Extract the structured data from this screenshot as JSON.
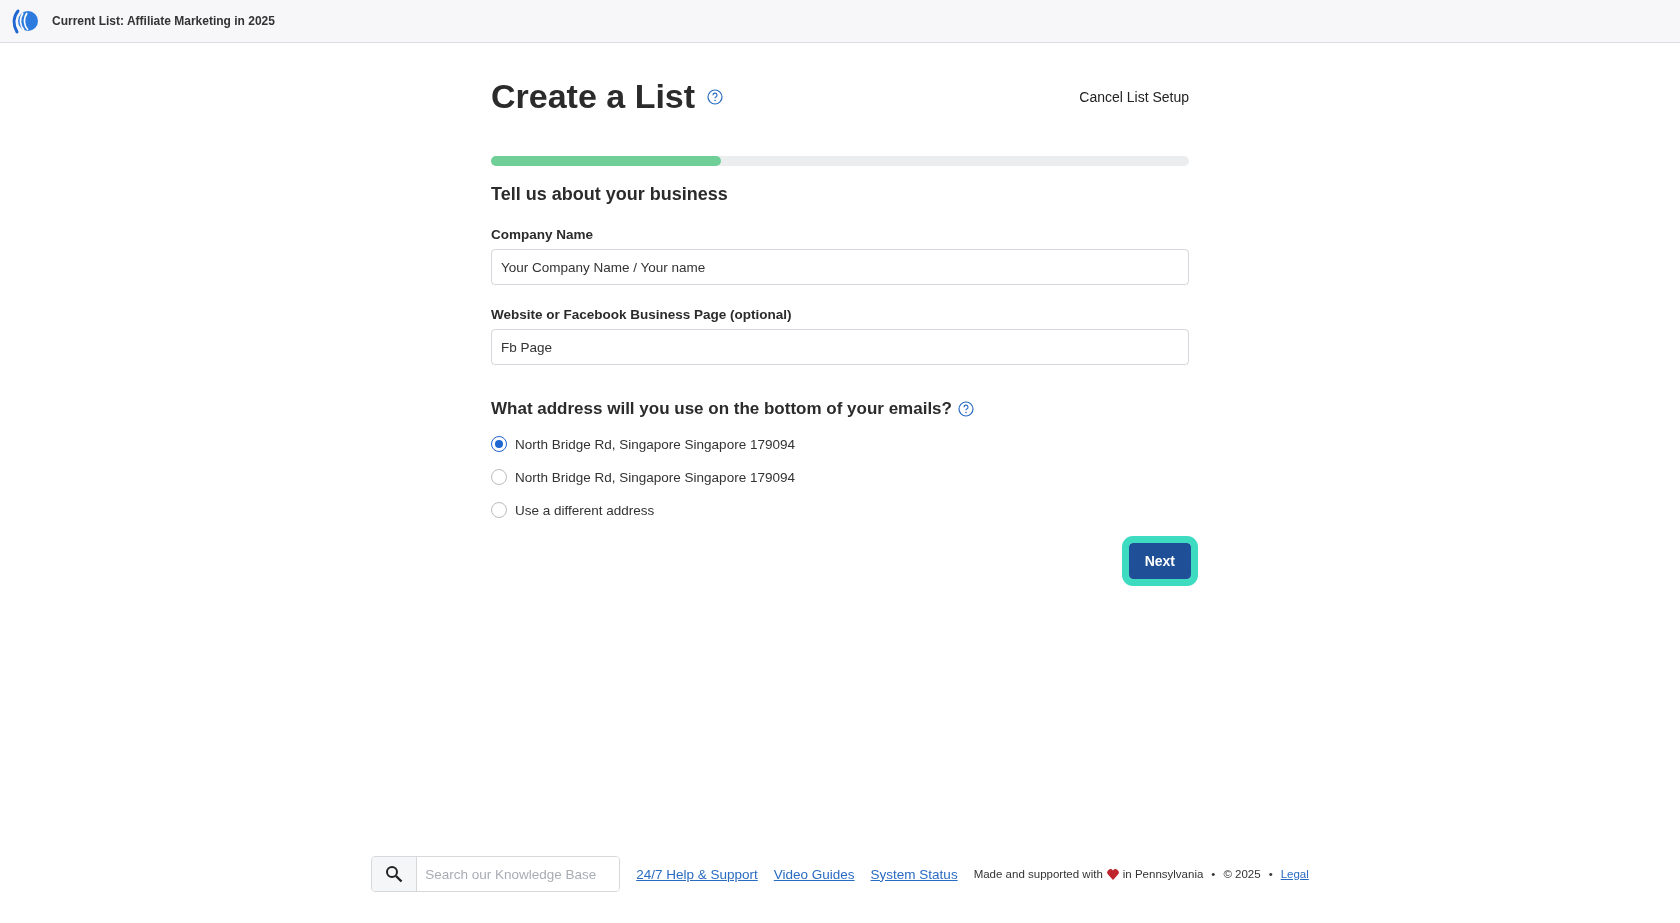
{
  "header": {
    "title": "Current List: Affiliate Marketing in 2025"
  },
  "page": {
    "title": "Create a List",
    "cancel": "Cancel List Setup"
  },
  "progress": {
    "level": 0.33
  },
  "section_title": "Tell us about your business",
  "fields": [
    {
      "label": "Company Name",
      "value": "Your Company Name / Your name"
    },
    {
      "label": "Website or Facebook Business Page (optional)",
      "value": "Fb Page"
    }
  ],
  "address": {
    "question": "What address will you use on the bottom of your emails?",
    "options": [
      {
        "label": "North Bridge Rd, Singapore Singapore 179094",
        "selected": true
      },
      {
        "label": "North Bridge Rd, Singapore Singapore 179094",
        "selected": false
      },
      {
        "label": "Use a different address",
        "selected": false
      }
    ]
  },
  "next_button": {
    "label": "Next",
    "focused": true
  },
  "footer": {
    "search": {
      "placeholder": "Search our Knowledge Base"
    },
    "links": [
      "24/7 Help & Support",
      "Video Guides",
      "System Status"
    ],
    "made_with": "Made and supported with",
    "location": "in Pennsylvania",
    "separators": [
      "•",
      "•"
    ],
    "copyright": "© 2025",
    "legal": "Legal"
  }
}
